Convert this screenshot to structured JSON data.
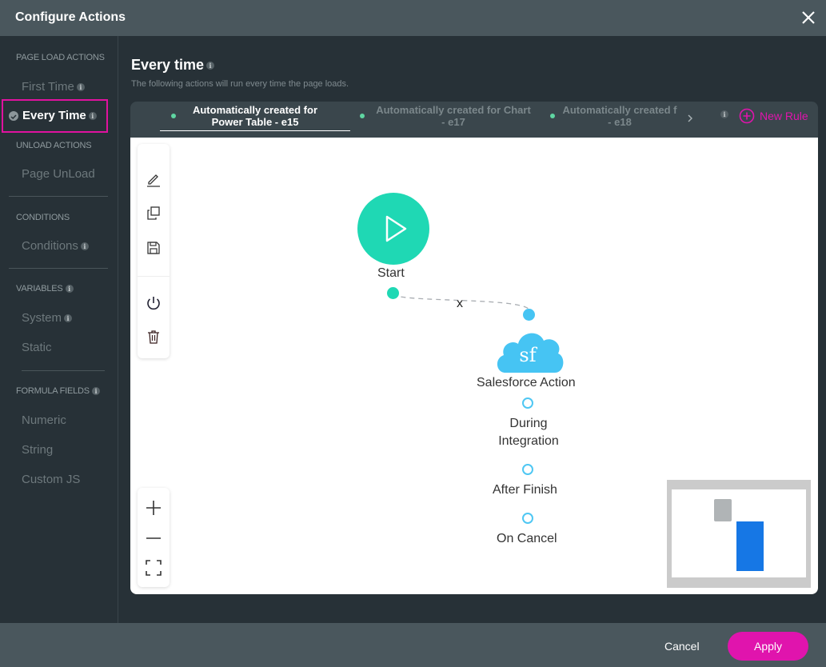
{
  "header": {
    "title": "Configure Actions",
    "close_icon": "close-icon"
  },
  "sidebar": {
    "sections": [
      {
        "label": "PAGE LOAD ACTIONS"
      },
      {
        "label": "UNLOAD ACTIONS"
      },
      {
        "label": "CONDITIONS"
      },
      {
        "label": "VARIABLES"
      },
      {
        "label": "FORMULA FIELDS"
      }
    ],
    "items": {
      "first_time": "First Time",
      "every_time": "Every Time",
      "page_unload": "Page UnLoad",
      "conditions": "Conditions",
      "system": "System",
      "static": "Static",
      "numeric": "Numeric",
      "string": "String",
      "custom_js": "Custom JS"
    },
    "info_glyph": "i"
  },
  "main": {
    "title": "Every time",
    "subtitle": "The following actions will run every time the page loads.",
    "tabs": [
      {
        "label_line1": "Automatically created for",
        "label_line2": "Power Table - e15",
        "active": true
      },
      {
        "label_line1": "Automatically created for Chart",
        "label_line2": "- e17",
        "active": false
      },
      {
        "label_line1": "Automatically created f",
        "label_line2": "- e18",
        "active": false
      }
    ],
    "new_rule_label": "New Rule",
    "accent_color": "#e014ad"
  },
  "canvas": {
    "start_node": {
      "label": "Start",
      "color": "#1fd8b4"
    },
    "connector_remove": "x",
    "action_node": {
      "label": "Salesforce Action",
      "icon_text": "sf",
      "color": "#46c4f3"
    },
    "outputs": [
      {
        "label_line1": "During",
        "label_line2": "Integration"
      },
      {
        "label_line1": "After Finish",
        "label_line2": ""
      },
      {
        "label_line1": "On Cancel",
        "label_line2": ""
      }
    ]
  },
  "footer": {
    "cancel_label": "Cancel",
    "apply_label": "Apply"
  }
}
